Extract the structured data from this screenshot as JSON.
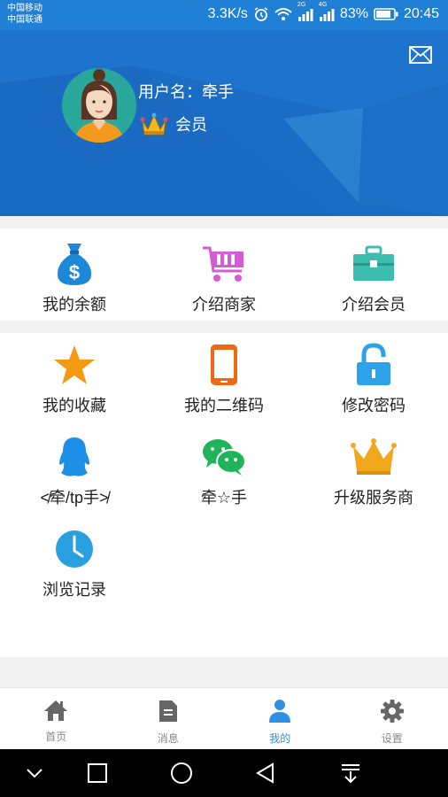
{
  "status_bar": {
    "carrier1": "中国移动",
    "carrier2": "中国联通",
    "speed": "3.3K/s",
    "net1": "2G",
    "net2": "4G",
    "battery": "83%",
    "time": "20:45"
  },
  "profile": {
    "username": "用户名：牵手",
    "member": "会员"
  },
  "section1": [
    {
      "label": "我的余额",
      "icon": "money-bag-icon",
      "color": "#1e88d8"
    },
    {
      "label": "介绍商家",
      "icon": "cart-icon",
      "color": "#d65bd6"
    },
    {
      "label": "介绍会员",
      "icon": "toolbox-icon",
      "color": "#3dbdb0"
    }
  ],
  "section2": [
    {
      "label": "我的收藏",
      "icon": "star-icon",
      "color": "#f39a12"
    },
    {
      "label": "我的二维码",
      "icon": "phone-icon",
      "color": "#ee6a12"
    },
    {
      "label": "修改密码",
      "icon": "lock-icon",
      "color": "#2ea2e8"
    },
    {
      "label": "≮牵/tp手≯",
      "icon": "qq-icon",
      "color": "#1e8fe6"
    },
    {
      "label": "牵☆手",
      "icon": "wechat-icon",
      "color": "#20b45a"
    },
    {
      "label": "升级服务商",
      "icon": "crown-icon",
      "color": "#f2a81d"
    },
    {
      "label": "浏览记录",
      "icon": "clock-icon",
      "color": "#2a9fe0"
    }
  ],
  "bottom_nav": [
    {
      "label": "首页",
      "icon": "home-icon"
    },
    {
      "label": "消息",
      "icon": "message-icon"
    },
    {
      "label": "我的",
      "icon": "user-icon",
      "active": true
    },
    {
      "label": "设置",
      "icon": "gear-icon"
    }
  ]
}
